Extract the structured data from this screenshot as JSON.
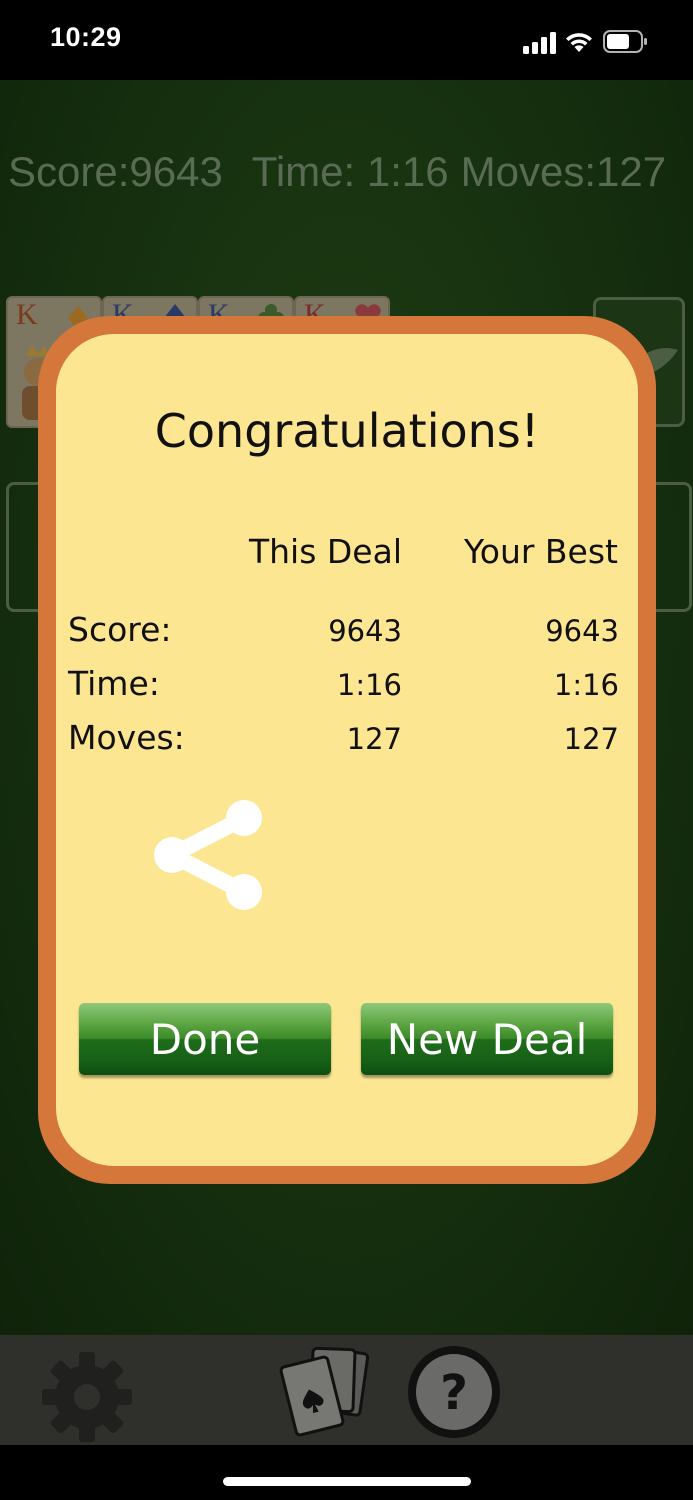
{
  "status_bar": {
    "time": "10:29"
  },
  "game": {
    "score_label": "Score:9643",
    "time_label": "Time: 1:16",
    "moves_label": "Moves:127",
    "foundation_ranks": [
      "K",
      "K",
      "K",
      "K"
    ]
  },
  "dialog": {
    "title": "Congratulations!",
    "columns": [
      "This Deal",
      "Your Best"
    ],
    "rows": [
      {
        "label": "Score:",
        "this_deal": "9643",
        "best": "9643"
      },
      {
        "label": "Time:",
        "this_deal": "1:16",
        "best": "1:16"
      },
      {
        "label": "Moves:",
        "this_deal": "127",
        "best": "127"
      }
    ],
    "done_label": "Done",
    "new_deal_label": "New Deal"
  },
  "toolbar": {
    "help_glyph": "?",
    "icons": [
      "gear-icon",
      "cards-icon",
      "help-icon"
    ]
  },
  "colors": {
    "dialog_border": "#d5773a",
    "dialog_fill": "#fde692",
    "button_green": "#1f6d1b",
    "table_green": "#16300f"
  }
}
